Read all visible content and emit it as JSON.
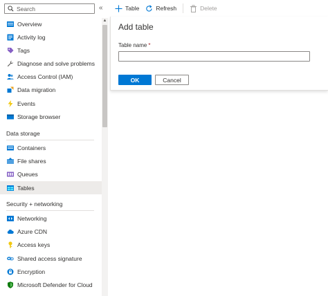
{
  "sidebar": {
    "search_placeholder": "Search",
    "collapse_glyph": "«",
    "items_top": [
      {
        "label": "Overview",
        "icon": "overview-icon"
      },
      {
        "label": "Activity log",
        "icon": "activity-log-icon"
      },
      {
        "label": "Tags",
        "icon": "tag-icon"
      },
      {
        "label": "Diagnose and solve problems",
        "icon": "wrench-icon"
      },
      {
        "label": "Access Control (IAM)",
        "icon": "people-icon"
      },
      {
        "label": "Data migration",
        "icon": "migration-icon"
      },
      {
        "label": "Events",
        "icon": "lightning-icon"
      },
      {
        "label": "Storage browser",
        "icon": "storage-browser-icon"
      }
    ],
    "section_data_storage": "Data storage",
    "items_data_storage": [
      {
        "label": "Containers",
        "icon": "containers-icon"
      },
      {
        "label": "File shares",
        "icon": "file-shares-icon"
      },
      {
        "label": "Queues",
        "icon": "queues-icon"
      },
      {
        "label": "Tables",
        "icon": "tables-icon",
        "selected": true
      }
    ],
    "section_security": "Security + networking",
    "items_security": [
      {
        "label": "Networking",
        "icon": "networking-icon"
      },
      {
        "label": "Azure CDN",
        "icon": "cloud-icon"
      },
      {
        "label": "Access keys",
        "icon": "key-icon"
      },
      {
        "label": "Shared access signature",
        "icon": "link-icon"
      },
      {
        "label": "Encryption",
        "icon": "lock-icon"
      },
      {
        "label": "Microsoft Defender for Cloud",
        "icon": "shield-icon"
      }
    ]
  },
  "toolbar": {
    "table_label": "Table",
    "refresh_label": "Refresh",
    "delete_label": "Delete"
  },
  "panel": {
    "title": "Add table",
    "field_label": "Table name",
    "required_mark": "*",
    "field_value": "",
    "ok_label": "OK",
    "cancel_label": "Cancel"
  },
  "colors": {
    "accent": "#0078d4",
    "selected_bg": "#edebe9",
    "required": "#a4262c"
  }
}
